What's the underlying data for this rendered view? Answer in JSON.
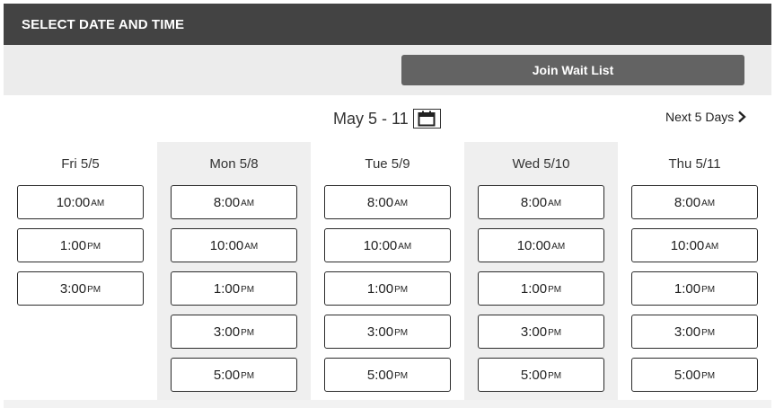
{
  "header": {
    "title": "SELECT DATE AND TIME"
  },
  "waitlist": {
    "button_label": "Join Wait List"
  },
  "range": {
    "label": "May 5 - 11",
    "icon": "calendar-icon"
  },
  "next": {
    "label": "Next 5 Days",
    "icon": "chevron-right-icon"
  },
  "days": [
    {
      "label": "Fri 5/5",
      "slots": [
        {
          "time": "10:00",
          "ampm": "AM"
        },
        {
          "time": "1:00",
          "ampm": "PM"
        },
        {
          "time": "3:00",
          "ampm": "PM"
        }
      ]
    },
    {
      "label": "Mon 5/8",
      "slots": [
        {
          "time": "8:00",
          "ampm": "AM"
        },
        {
          "time": "10:00",
          "ampm": "AM"
        },
        {
          "time": "1:00",
          "ampm": "PM"
        },
        {
          "time": "3:00",
          "ampm": "PM"
        },
        {
          "time": "5:00",
          "ampm": "PM"
        }
      ]
    },
    {
      "label": "Tue 5/9",
      "slots": [
        {
          "time": "8:00",
          "ampm": "AM"
        },
        {
          "time": "10:00",
          "ampm": "AM"
        },
        {
          "time": "1:00",
          "ampm": "PM"
        },
        {
          "time": "3:00",
          "ampm": "PM"
        },
        {
          "time": "5:00",
          "ampm": "PM"
        }
      ]
    },
    {
      "label": "Wed 5/10",
      "slots": [
        {
          "time": "8:00",
          "ampm": "AM"
        },
        {
          "time": "10:00",
          "ampm": "AM"
        },
        {
          "time": "1:00",
          "ampm": "PM"
        },
        {
          "time": "3:00",
          "ampm": "PM"
        },
        {
          "time": "5:00",
          "ampm": "PM"
        }
      ]
    },
    {
      "label": "Thu 5/11",
      "slots": [
        {
          "time": "8:00",
          "ampm": "AM"
        },
        {
          "time": "10:00",
          "ampm": "AM"
        },
        {
          "time": "1:00",
          "ampm": "PM"
        },
        {
          "time": "3:00",
          "ampm": "PM"
        },
        {
          "time": "5:00",
          "ampm": "PM"
        }
      ]
    }
  ],
  "colors": {
    "header_bg": "#434343",
    "button_bg": "#636363",
    "shaded_col": "#efefef"
  }
}
